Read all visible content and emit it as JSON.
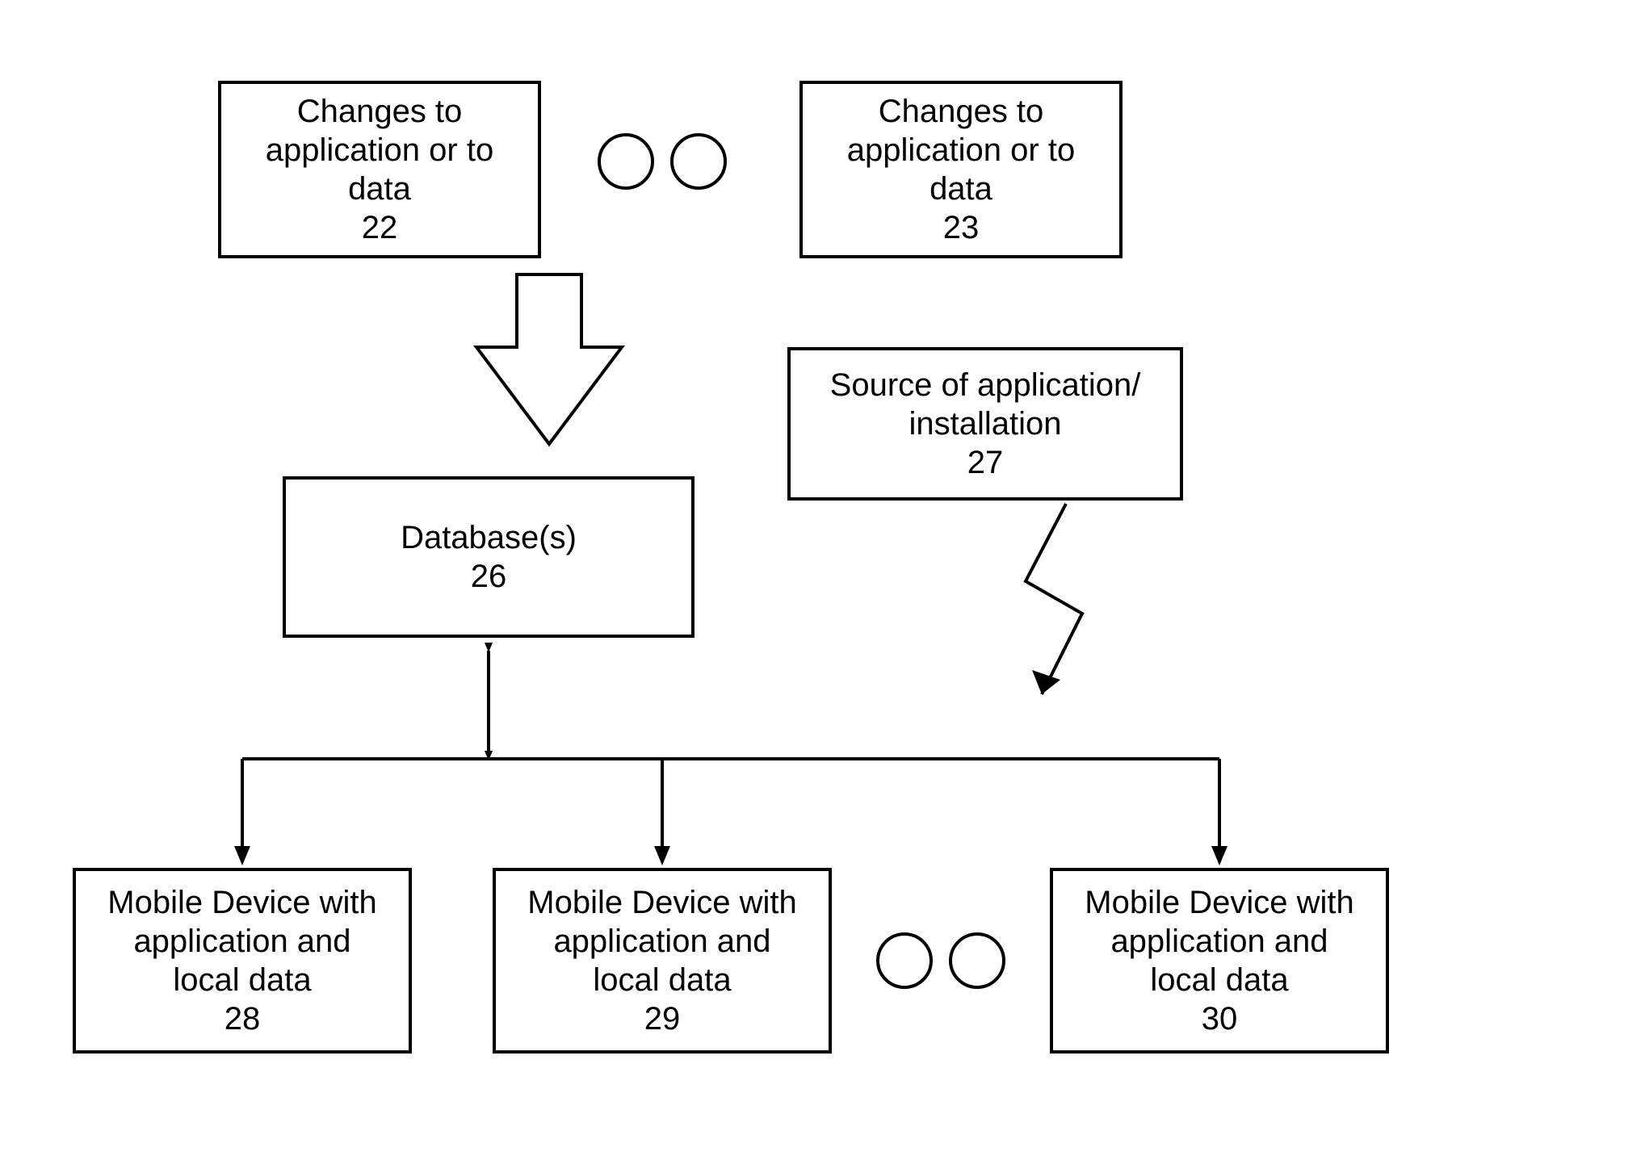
{
  "boxes": {
    "changes22": {
      "lines": [
        "Changes to",
        "application or to",
        "data",
        "22"
      ]
    },
    "changes23": {
      "lines": [
        "Changes to",
        "application or to",
        "data",
        "23"
      ]
    },
    "source27": {
      "lines": [
        "Source of application/",
        "installation",
        "27"
      ]
    },
    "database26": {
      "lines": [
        "Database(s)",
        "26"
      ]
    },
    "mobile28": {
      "lines": [
        "Mobile Device with",
        "application and",
        "local data",
        "28"
      ]
    },
    "mobile29": {
      "lines": [
        "Mobile Device with",
        "application and",
        "local data",
        "29"
      ]
    },
    "mobile30": {
      "lines": [
        "Mobile Device with",
        "application and",
        "local data",
        "30"
      ]
    }
  }
}
